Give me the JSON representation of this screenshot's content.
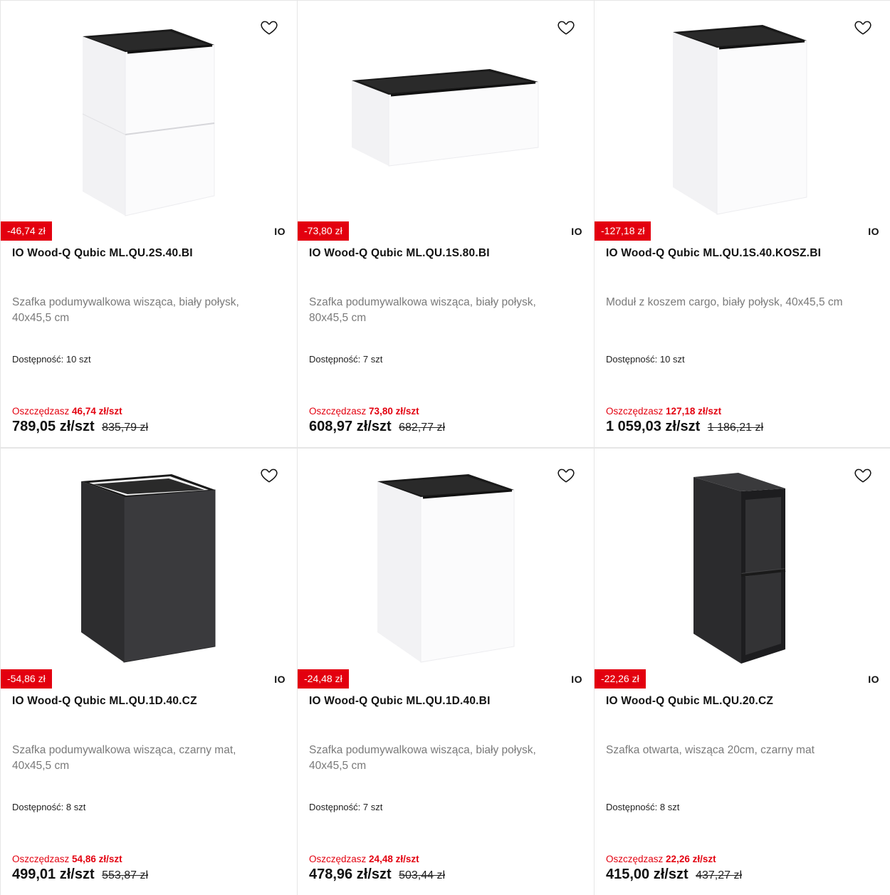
{
  "products": [
    {
      "discount": "-46,74 zł",
      "brand": "IO",
      "title": "IO Wood-Q Qubic ML.QU.2S.40.BI",
      "description": "Szafka podumywalkowa wisząca, biały połysk, 40x45,5 cm",
      "availability_label": "Dostępność:",
      "availability_value": "10 szt",
      "save_label": "Oszczędzasz",
      "save_amount": "46,74 zł/szt",
      "price": "789,05 zł/szt",
      "old_price": "835,79 zł",
      "image": "white-two-drawer-cabinet"
    },
    {
      "discount": "-73,80 zł",
      "brand": "IO",
      "title": "IO Wood-Q Qubic ML.QU.1S.80.BI",
      "description": "Szafka podumywalkowa wisząca, biały połysk, 80x45,5 cm",
      "availability_label": "Dostępność:",
      "availability_value": "7 szt",
      "save_label": "Oszczędzasz",
      "save_amount": "73,80 zł/szt",
      "price": "608,97 zł/szt",
      "old_price": "682,77 zł",
      "image": "white-wide-drawer-cabinet"
    },
    {
      "discount": "-127,18 zł",
      "brand": "IO",
      "title": "IO Wood-Q Qubic ML.QU.1S.40.KOSZ.BI",
      "description": "Moduł z koszem cargo, biały połysk, 40x45,5 cm",
      "availability_label": "Dostępność:",
      "availability_value": "10 szt",
      "save_label": "Oszczędzasz",
      "save_amount": "127,18 zł/szt",
      "price": "1 059,03 zł/szt",
      "old_price": "1 186,21 zł",
      "image": "white-tall-cargo-cabinet"
    },
    {
      "discount": "-54,86 zł",
      "brand": "IO",
      "title": "IO Wood-Q Qubic ML.QU.1D.40.CZ",
      "description": "Szafka podumywalkowa wisząca, czarny mat, 40x45,5 cm",
      "availability_label": "Dostępność:",
      "availability_value": "8 szt",
      "save_label": "Oszczędzasz",
      "save_amount": "54,86 zł/szt",
      "price": "499,01 zł/szt",
      "old_price": "553,87 zł",
      "image": "black-door-cabinet"
    },
    {
      "discount": "-24,48 zł",
      "brand": "IO",
      "title": "IO Wood-Q Qubic ML.QU.1D.40.BI",
      "description": "Szafka podumywalkowa wisząca, biały połysk, 40x45,5 cm",
      "availability_label": "Dostępność:",
      "availability_value": "7 szt",
      "save_label": "Oszczędzasz",
      "save_amount": "24,48 zł/szt",
      "price": "478,96 zł/szt",
      "old_price": "503,44 zł",
      "image": "white-door-cabinet"
    },
    {
      "discount": "-22,26 zł",
      "brand": "IO",
      "title": "IO Wood-Q Qubic ML.QU.20.CZ",
      "description": "Szafka otwarta, wisząca 20cm, czarny mat",
      "availability_label": "Dostępność:",
      "availability_value": "8 szt",
      "save_label": "Oszczędzasz",
      "save_amount": "22,26 zł/szt",
      "price": "415,00 zł/szt",
      "old_price": "437,27 zł",
      "image": "black-open-shelf-cabinet"
    }
  ]
}
